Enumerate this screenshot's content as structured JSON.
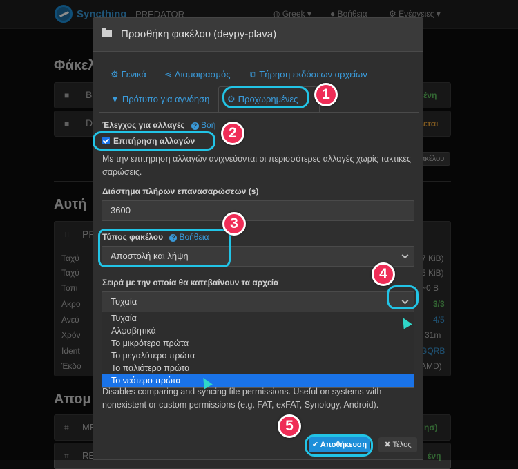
{
  "navbar": {
    "brand": "Syncthing",
    "device": "PREDATOR",
    "language": "Greek",
    "help": "Βοήθεια",
    "actions": "Ενέργειες"
  },
  "background": {
    "folders_heading": "Φάκελ",
    "folder1_letter": "B",
    "folder1_status": "ένη",
    "folder2_letter": "D",
    "folder2_status": "εται",
    "side_button": "ακέλου",
    "this_device_heading": "Αυτή",
    "device_short": "PR",
    "row_labels": [
      "Ταχύ",
      "Ταχύ",
      "Τοπι",
      "Ακρο",
      "Ανεύ",
      "Χρόν",
      "Ident",
      "Έκδο"
    ],
    "row_values": [
      "7 KiB)",
      "5 KiB)",
      "~0 B",
      "3/3",
      "4/5",
      "31m",
      "GQRB",
      "AMD)"
    ],
    "remote_heading": "Απομ",
    "remote1": "ME",
    "remote1_status": "ησ)",
    "remote2": "RE",
    "remote2_status": "ένη"
  },
  "modal": {
    "title": "Προσθήκη φακέλου (deypy-plava)",
    "tabs": {
      "general": "Γενικά",
      "sharing": "Διαμοιρασμός",
      "versioning": "Τήρηση εκδόσεων αρχείων",
      "ignore": "Πρότυπο για αγνόηση",
      "advanced": "Προχωρημένες"
    },
    "watch_label": "Έλεγχος για αλλαγές",
    "help_text": "Βοήθεια",
    "help_cut": "Βοή",
    "watch_checkbox": "Επιτήρηση αλλαγών",
    "watch_hint": "Με την επιτήρηση αλλαγών ανιχνεύονται οι περισσότερες αλλαγές χωρίς τακτικές σαρώσεις.",
    "rescan_label": "Διάστημα πλήρων επανασαρώσεων (s)",
    "rescan_value": "3600",
    "folder_type_label": "Τύπος φακέλου",
    "folder_type_value": "Αποστολή και λήψη",
    "pull_order_label": "Σειρά με την οποία θα κατεβαίνουν τα αρχεία",
    "pull_order_value": "Τυχαία",
    "pull_order_options": [
      "Τυχαία",
      "Αλφαβητικά",
      "Το μικρότερο πρώτα",
      "Το μεγαλύτερο πρώτα",
      "Το παλιότερο πρώτα",
      "Το νεότερο πρώτα"
    ],
    "permissions_hint": "Disables comparing and syncing file permissions. Useful on systems with nonexistent or custom permissions (e.g. FAT, exFAT, Synology, Android).",
    "save_button": "Αποθήκευση",
    "close_button": "Τέλος"
  },
  "annotations": [
    "1",
    "2",
    "3",
    "4",
    "5"
  ],
  "colors": {
    "accent": "#3a9ad9",
    "annotation_ring": "#22c4e6",
    "annotation_badge": "#ef2d57",
    "selected_option": "#1a73e8"
  }
}
